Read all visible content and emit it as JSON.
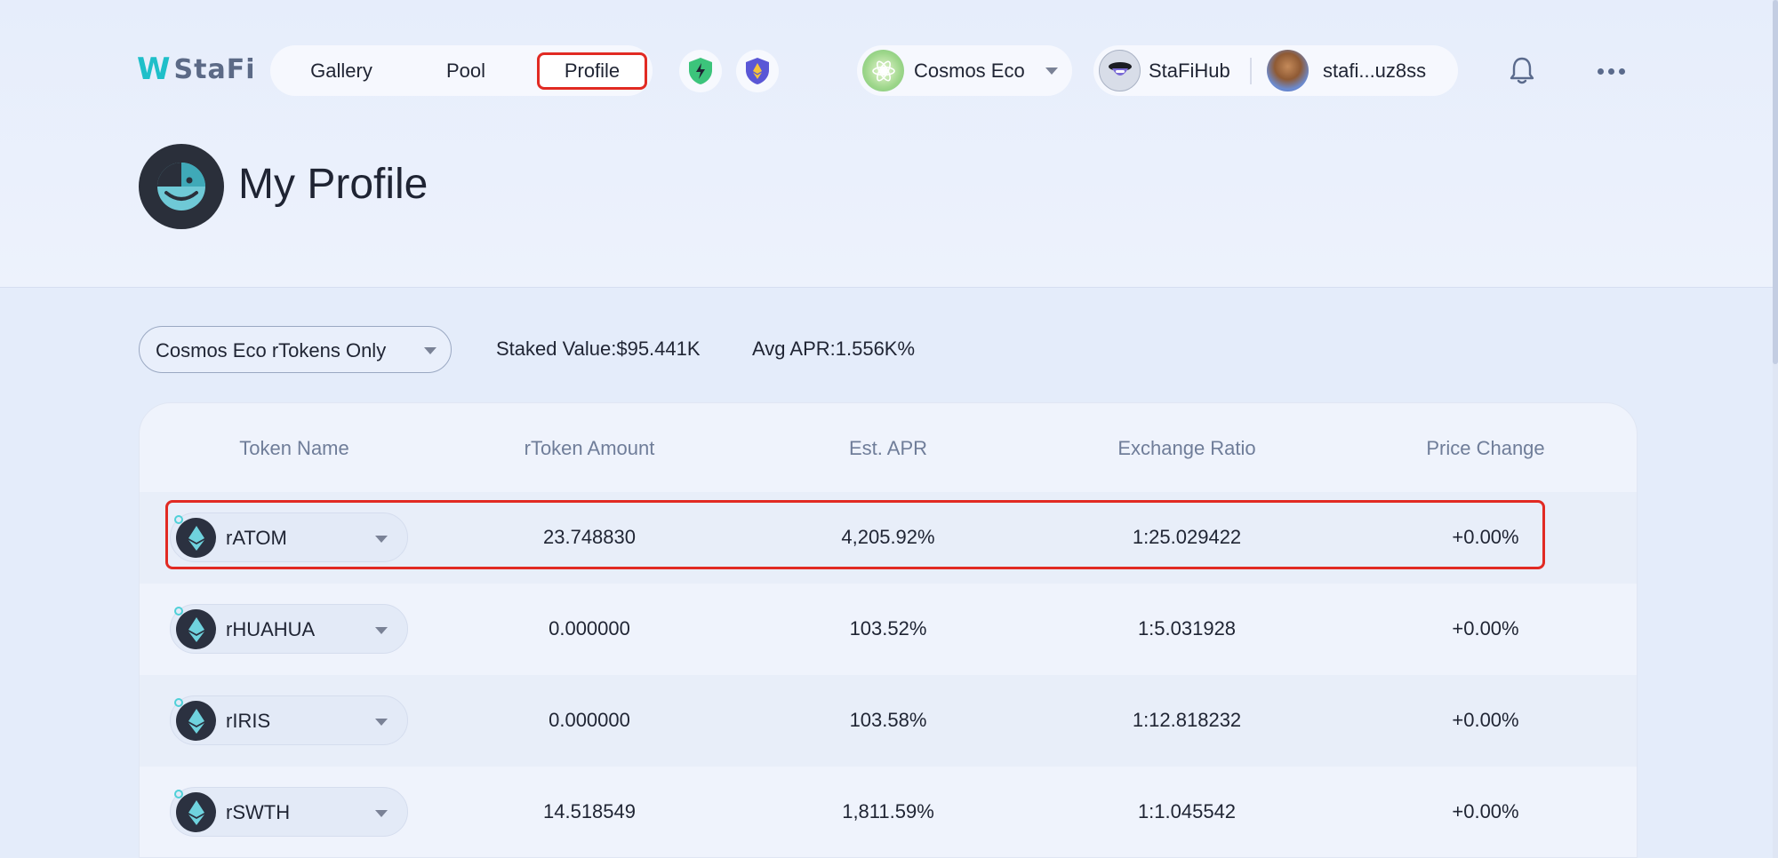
{
  "header": {
    "logo_mark": "W",
    "logo_word": "StaFi",
    "nav": {
      "gallery": "Gallery",
      "pool": "Pool",
      "profile": "Profile"
    },
    "eco_selector": "Cosmos Eco",
    "hub_label": "StaFiHub",
    "account_label": "stafi...uz8ss"
  },
  "page": {
    "title": "My Profile"
  },
  "filter": {
    "selected": "Cosmos Eco rTokens Only",
    "staked_value": "Staked Value:$95.441K",
    "avg_apr": "Avg APR:1.556K%"
  },
  "table": {
    "headers": {
      "token_name": "Token Name",
      "amount": "rToken Amount",
      "apr": "Est. APR",
      "ratio": "Exchange Ratio",
      "price": "Price Change"
    },
    "rows": [
      {
        "token": "rATOM",
        "amount": "23.748830",
        "apr": "4,205.92%",
        "ratio": "1:25.029422",
        "price": "+0.00%"
      },
      {
        "token": "rHUAHUA",
        "amount": "0.000000",
        "apr": "103.52%",
        "ratio": "1:5.031928",
        "price": "+0.00%"
      },
      {
        "token": "rIRIS",
        "amount": "0.000000",
        "apr": "103.58%",
        "ratio": "1:12.818232",
        "price": "+0.00%"
      },
      {
        "token": "rSWTH",
        "amount": "14.518549",
        "apr": "1,811.59%",
        "ratio": "1:1.045542",
        "price": "+0.00%"
      }
    ]
  },
  "colors": {
    "accent": "#1fbfc9",
    "highlight_border": "#e12a23",
    "background": "#e4ecfa"
  },
  "icons": [
    "shield-bolt-icon",
    "shield-eth-icon",
    "cosmos-eco-icon",
    "stafihub-icon",
    "user-avatar",
    "bell-icon",
    "more-icon",
    "eth-token-icon"
  ]
}
